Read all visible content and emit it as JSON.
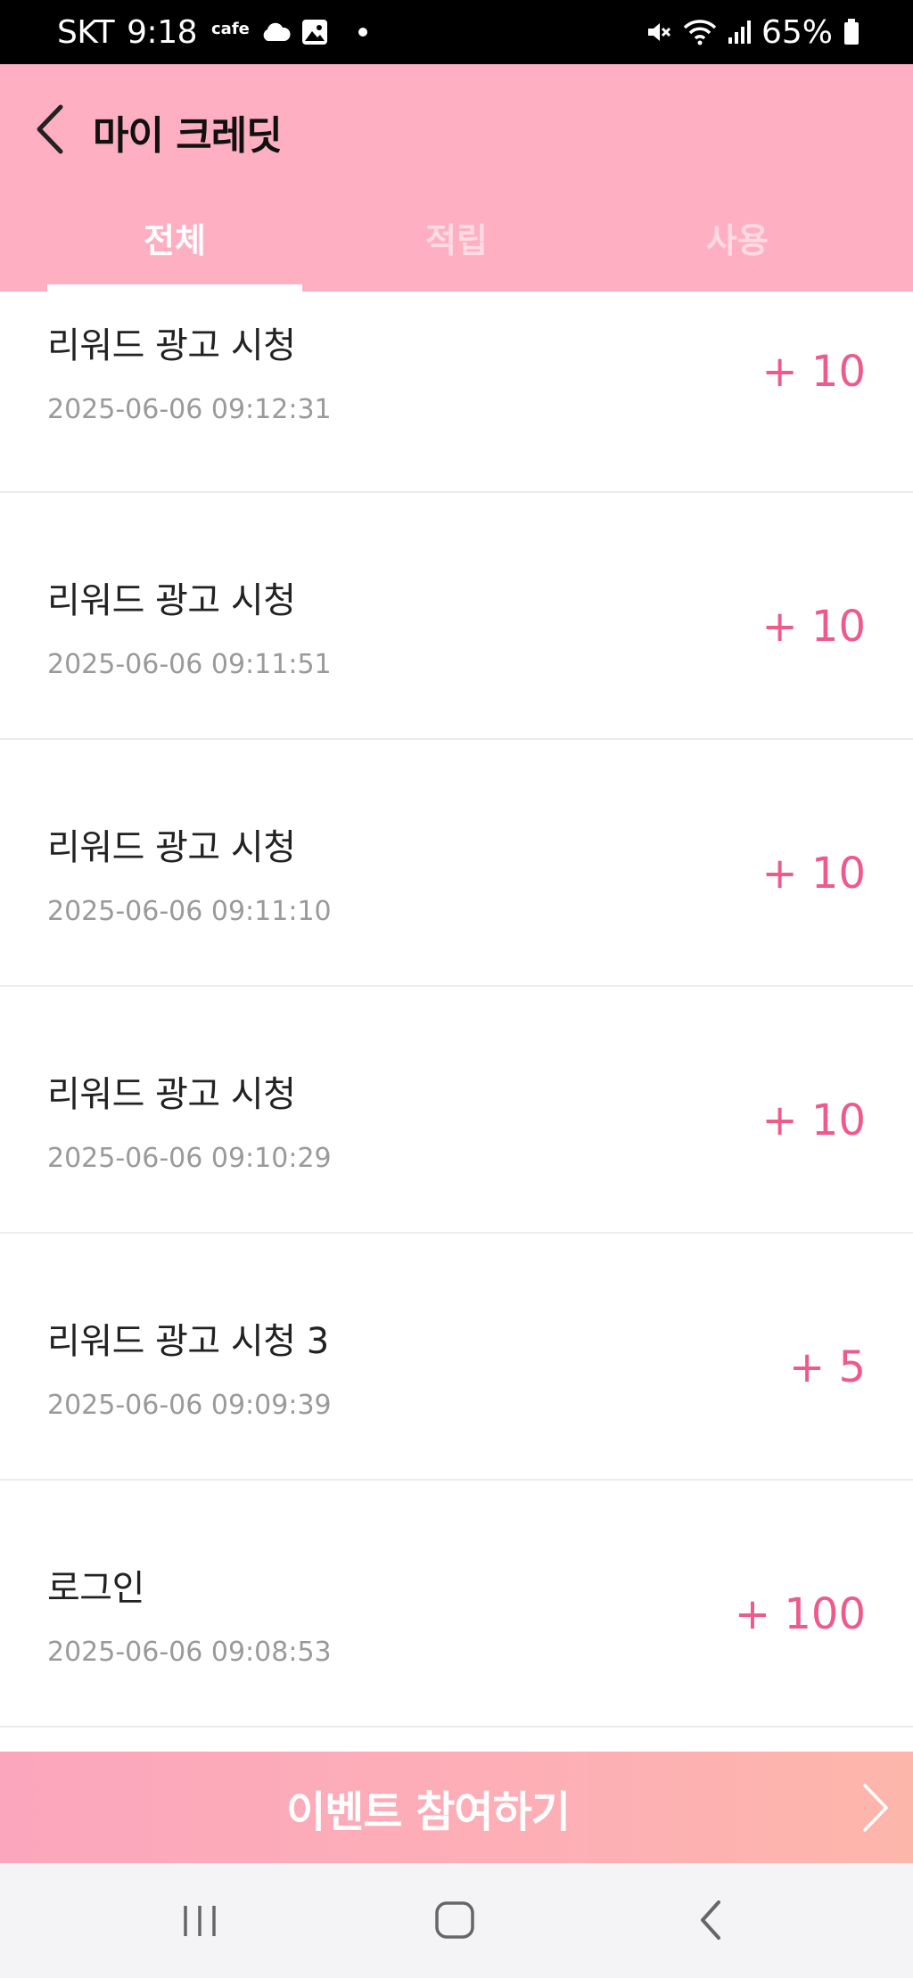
{
  "status_bar": {
    "carrier": "SKT",
    "time": "9:18",
    "cafe_label": "cafe",
    "battery": "65%",
    "icons": [
      "cloud-icon",
      "image-icon",
      "dot-icon",
      "mute-icon",
      "wifi-icon",
      "signal-icon",
      "battery-icon"
    ]
  },
  "header": {
    "title": "마이 크레딧",
    "back_icon": "chevron-left-icon",
    "background": "#ffafc2"
  },
  "tabs": [
    {
      "label": "전체",
      "active": true
    },
    {
      "label": "적립",
      "active": false
    },
    {
      "label": "사용",
      "active": false
    }
  ],
  "history": [
    {
      "title": "리워드 광고 시청",
      "date": "2025-06-06 09:12:31",
      "amount": "+ 10"
    },
    {
      "title": "리워드 광고 시청",
      "date": "2025-06-06 09:11:51",
      "amount": "+ 10"
    },
    {
      "title": "리워드 광고 시청",
      "date": "2025-06-06 09:11:10",
      "amount": "+ 10"
    },
    {
      "title": "리워드 광고 시청",
      "date": "2025-06-06 09:10:29",
      "amount": "+ 10"
    },
    {
      "title": "리워드 광고 시청 3",
      "date": "2025-06-06 09:09:39",
      "amount": "+ 5"
    },
    {
      "title": "로그인",
      "date": "2025-06-06 09:08:53",
      "amount": "+ 100"
    }
  ],
  "event_button": {
    "label": "이벤트 참여하기",
    "icon": "chevron-right-icon"
  },
  "colors": {
    "accent_pink": "#ffafc2",
    "amount_pink": "#ee5a8a"
  },
  "nav_bar": {
    "buttons": [
      "recent-apps-icon",
      "home-icon",
      "back-icon"
    ]
  }
}
